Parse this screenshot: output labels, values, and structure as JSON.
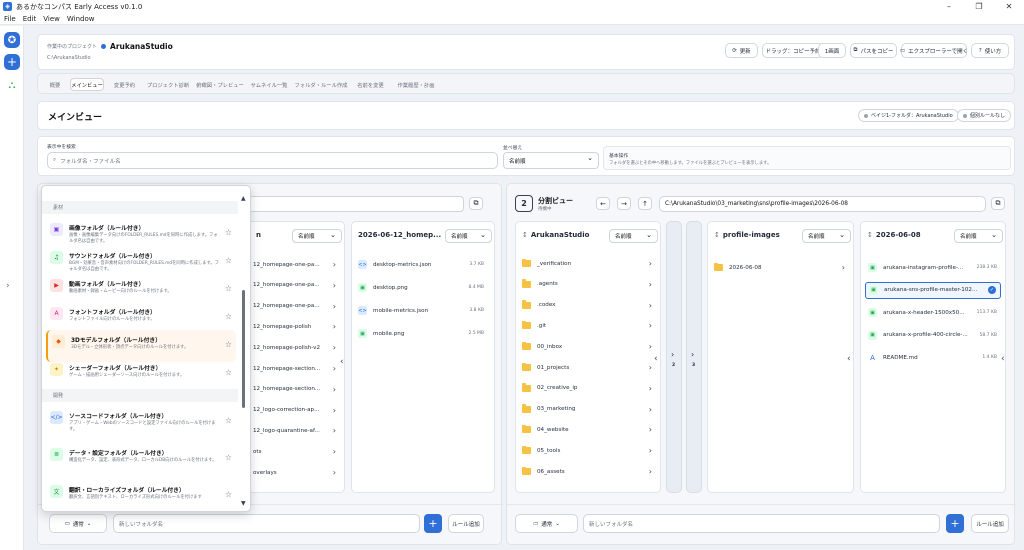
{
  "window": {
    "title": "あるかなコンパス Early Access v0.1.0"
  },
  "menu": [
    "File",
    "Edit",
    "View",
    "Window"
  ],
  "project": {
    "label": "作業中のプロジェクト",
    "name": "ArukanaStudio",
    "path": "C:\\ArukanaStudio"
  },
  "toolbar": {
    "refresh": "更新",
    "drag_copy": "ドラッグ：コピー予約",
    "one_screen": "1画面",
    "path_copy": "パスをコピー",
    "open_explorer": "エクスプローラーで開く",
    "help": "使い方"
  },
  "tabs": [
    "概要",
    "メインビュー",
    "変更予約",
    "プロジェクト診断",
    "俯瞰図・プレビュー",
    "サムネイル一覧",
    "フォルダ・ルール作成",
    "名前を変更",
    "作業履歴・計画"
  ],
  "active_tab": "メインビュー",
  "main_title": "メインビュー",
  "badges": {
    "base_folder": "ベイジ1-フォルダ：ArukanaStudio",
    "individual_rule": "個別ルールなし"
  },
  "search": {
    "label": "表示中を検索",
    "placeholder": "フォルダ名・ファイル名"
  },
  "sort": {
    "label": "並べ替え",
    "value": "名前順"
  },
  "basic_ops": {
    "label": "基本操作",
    "hint": "フォルダを選ぶとその中へ移動します。ファイルを選ぶとプレビューを表示します。"
  },
  "left_pane": {
    "path_placeholder": "",
    "column_a": {
      "title": "n",
      "sort": "名前順",
      "rows": [
        "12_homepage-one-pa...",
        "12_homepage-one-pa...",
        "12_homepage-one-pa...",
        "12_homepage-polish",
        "12_homepage-polish-v2",
        "12_homepage-section...",
        "12_homepage-section...",
        "12_logo-correction-ap...",
        "12_logo-quarantine-af...",
        "ots",
        "overlays"
      ]
    },
    "column_b": {
      "title": "2026-06-12_homep...",
      "sort": "名前順",
      "files": [
        {
          "name": "desktop-metrics.json",
          "size": "3.7 KB",
          "kind": "json"
        },
        {
          "name": "desktop.png",
          "size": "8.4 MB",
          "kind": "image"
        },
        {
          "name": "mobile-metrics.json",
          "size": "3.8 KB",
          "kind": "json"
        },
        {
          "name": "mobile.png",
          "size": "2.5 MB",
          "kind": "image"
        }
      ]
    },
    "new_folder_type": "通常",
    "new_folder_placeholder": "新しいフォルダ名",
    "add_rule": "ルール追加"
  },
  "dropdown": {
    "sections": [
      {
        "title": "素材",
        "items": [
          {
            "title": "画像フォルダ（ルール付き）",
            "desc": "画像・画像編集データ向けのFOLDER_RULES.mdを同時に作成します。フォルダ名は自由です。",
            "icon": "image-icon",
            "glyph": "▣",
            "bg": "#ede9fe",
            "fg": "#7c3aed"
          },
          {
            "title": "サウンドフォルダ（ルール付き）",
            "desc": "BGM・効果音・音声素材向けのFOLDER_RULES.mdを同時に作成します。フォルダ名は自由です。",
            "icon": "music-icon",
            "glyph": "♫",
            "bg": "#dcfce7",
            "fg": "#15803d"
          },
          {
            "title": "動画フォルダ（ルール付き）",
            "desc": "動画素材・録画・ムービー向けのルールを付けます。",
            "icon": "video-icon",
            "glyph": "▶",
            "bg": "#fee2e2",
            "fg": "#dc2626"
          },
          {
            "title": "フォントフォルダ（ルール付き）",
            "desc": "フォントファイル向けのルールを付けます。",
            "icon": "font-icon",
            "glyph": "A",
            "bg": "#fce7f3",
            "fg": "#db2777"
          },
          {
            "title": "3Dモデルフォルダ（ルール付き）",
            "desc": "3Dモデル・立体形状・頂点データ向けのルールを付けます。",
            "icon": "cube-icon",
            "glyph": "◆",
            "bg": "#ffedd5",
            "fg": "#ea580c",
            "selected": true
          },
          {
            "title": "シェーダーフォルダ（ルール付き）",
            "desc": "ゲーム・描画用シェーダーソース向けのルールを付けます。",
            "icon": "shader-icon",
            "glyph": "✦",
            "bg": "#fef3c7",
            "fg": "#ca8a04"
          }
        ]
      },
      {
        "title": "開発",
        "items": [
          {
            "title": "ソースコードフォルダ（ルール付き）",
            "desc": "アプリ・ゲーム・Webのソースコードと設定ファイル向けのルールを付けます。",
            "icon": "code-icon",
            "glyph": "</>",
            "bg": "#dbeafe",
            "fg": "#2563eb"
          },
          {
            "title": "データ・設定フォルダ（ルール付き）",
            "desc": "構造化データ、設定、表形式データ、ローカルDB向けのルールを付けます。",
            "icon": "database-icon",
            "glyph": "≣",
            "bg": "#dcfce7",
            "fg": "#16a34a"
          },
          {
            "title": "翻訳・ローカライズフォルダ（ルール付き）",
            "desc": "翻訳文、言語別テキスト、ローカライズ形式向けのルールを付けます",
            "icon": "translate-icon",
            "glyph": "文",
            "bg": "#dcfce7",
            "fg": "#16a34a"
          }
        ]
      }
    ]
  },
  "right_pane": {
    "number": "2",
    "title": "分割ビュー",
    "status": "待機中",
    "path": "C:\\ArukanaStudio\\03_marketing\\sns\\profile-images\\2026-06-08",
    "col1": {
      "title": "ArukanaStudio",
      "sort": "名前順",
      "rows": [
        "_verification",
        ".agents",
        ".codex",
        ".git",
        "00_inbox",
        "01_projects",
        "02_creative_ip",
        "03_marketing",
        "04_website",
        "05_tools",
        "06_assets"
      ]
    },
    "collapsed": [
      "2",
      "3"
    ],
    "col2": {
      "title": "profile-images",
      "sort": "名前順",
      "rows": [
        "2026-06-08"
      ]
    },
    "col3": {
      "title": "2026-06-08",
      "sort": "名前順",
      "files": [
        {
          "name": "arukana-instagram-profile-...",
          "size": "238.3 KB",
          "kind": "image"
        },
        {
          "name": "arukana-sns-profile-master-102...",
          "size": "",
          "kind": "image",
          "selected": true
        },
        {
          "name": "arukana-x-header-1500x50...",
          "size": "113.7 KB",
          "kind": "image"
        },
        {
          "name": "arukana-x-profile-400-circle-...",
          "size": "58.7 KB",
          "kind": "image"
        },
        {
          "name": "README.md",
          "size": "1.4 KB",
          "kind": "markdown"
        }
      ]
    },
    "new_folder_type": "通常",
    "new_folder_placeholder": "新しいフォルダ名",
    "add_rule": "ルール追加"
  }
}
